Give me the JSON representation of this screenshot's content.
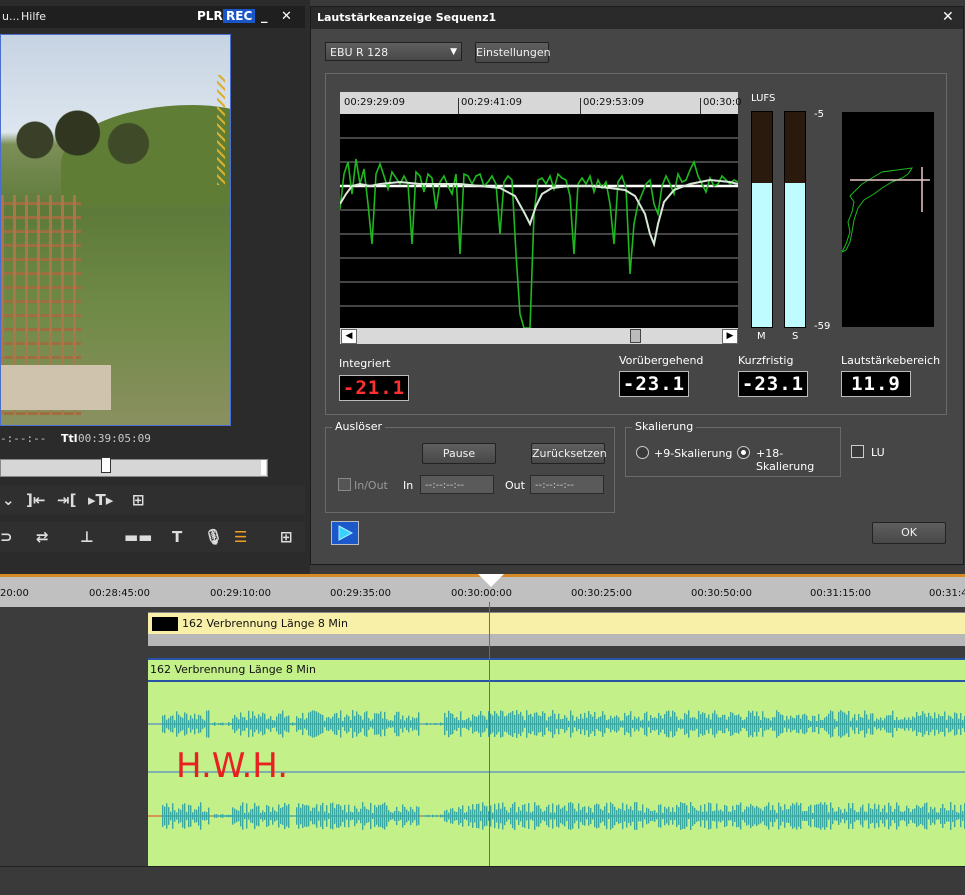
{
  "player": {
    "menu": [
      "u...",
      "Hilfe"
    ],
    "plr_label": "PLR",
    "rec_label": "REC",
    "minimize": "_",
    "close": "✕",
    "timecode_in": "-:--:--",
    "ttl_label": "Ttl",
    "ttl_value": "00:39:05:09"
  },
  "dialog": {
    "title": "Lautstärkeanzeige  Sequenz1",
    "close": "✕",
    "mode_value": "EBU R 128",
    "settings_label": "Einstellungen",
    "ruler": [
      "00:29:29:09",
      "00:29:41:09",
      "00:29:53:09",
      "00:30:0"
    ],
    "lufs_label": "LUFS",
    "lufs_top": "-5",
    "lufs_bottom": "-59",
    "meters": {
      "m_label": "M",
      "s_label": "S",
      "m_level": 0.67,
      "s_level": 0.67
    },
    "readouts": {
      "integrated_label": "Integriert",
      "integrated_value": "-21.1",
      "momentary_label": "Vorübergehend",
      "momentary_value": "-23.1",
      "shortterm_label": "Kurzfristig",
      "shortterm_value": "-23.1",
      "range_label": "Lautstärkebereich",
      "range_value": "11.9"
    },
    "trigger": {
      "title": "Auslöser",
      "pause": "Pause",
      "reset": "Zurücksetzen",
      "inout": "In/Out",
      "in_label": "In",
      "in_value": "--:--:--:--",
      "out_label": "Out",
      "out_value": "--:--:--:--"
    },
    "scale": {
      "title": "Skalierung",
      "option9": "+9-Skalierung",
      "option18": "+18-Skalierung",
      "selected": "+18-Skalierung"
    },
    "lu_label": "LU",
    "ok": "OK"
  },
  "timeline": {
    "ruler": [
      "20:00",
      "00:28:45:00",
      "00:29:10:00",
      "00:29:35:00",
      "00:30:00:00",
      "00:30:25:00",
      "00:30:50:00",
      "00:31:15:00",
      "00:31:4"
    ],
    "video_clip": "162 Verbrennung Länge 8 Min",
    "audio_clip": "162 Verbrennung Länge 8 Min",
    "watermark": "H.W.H."
  },
  "colors": {
    "accent_blue": "#1a56c8",
    "meter_fill": "#bffcff",
    "graph_green": "#1fb81f",
    "integrated_red": "#ff3030",
    "audio_clip": "#c4f08a",
    "waveform": "#3aa8a0"
  }
}
